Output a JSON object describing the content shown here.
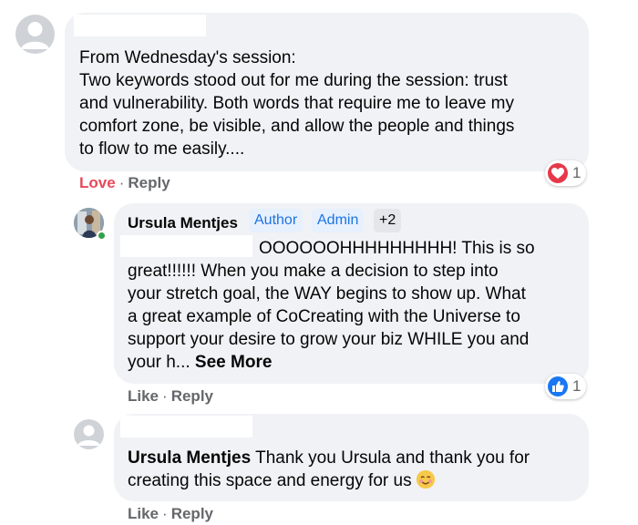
{
  "comments": [
    {
      "text": "From Wednesday's session:\nTwo keywords stood out for me during the session: trust\nand vulnerability. Both words that require me to leave my\ncomfort zone, be visible, and allow the people and things\nto flow to me easily....",
      "actions": {
        "love": "Love",
        "reply": "Reply",
        "sep": "·"
      },
      "reaction": {
        "icon": "heart-icon",
        "count": "1",
        "color": "#e5394a"
      }
    },
    {
      "author": "Ursula Mentjes",
      "badges": [
        "Author",
        "Admin",
        "+2"
      ],
      "lines": [
        "OOOOOOHHHHHHHHH! This is so",
        "great!!!!!! When you make a decision to step into",
        "your stretch goal, the WAY begins to show up. What",
        "a great example of CoCreating with the Universe to",
        "support your desire to grow your biz WHILE you and",
        "your h... "
      ],
      "see_more": "See More",
      "actions": {
        "like": "Like",
        "reply": "Reply",
        "sep": "·"
      },
      "reaction": {
        "icon": "thumbs-up-icon",
        "count": "1",
        "color": "#1a77f2"
      }
    },
    {
      "author": "Ursula Mentjes",
      "text_1": "Thank you Ursula and thank you for",
      "text_2": "creating this space and energy for us",
      "emoji": "smiling-face-icon",
      "actions": {
        "like": "Like",
        "reply": "Reply",
        "sep": "·"
      }
    }
  ]
}
